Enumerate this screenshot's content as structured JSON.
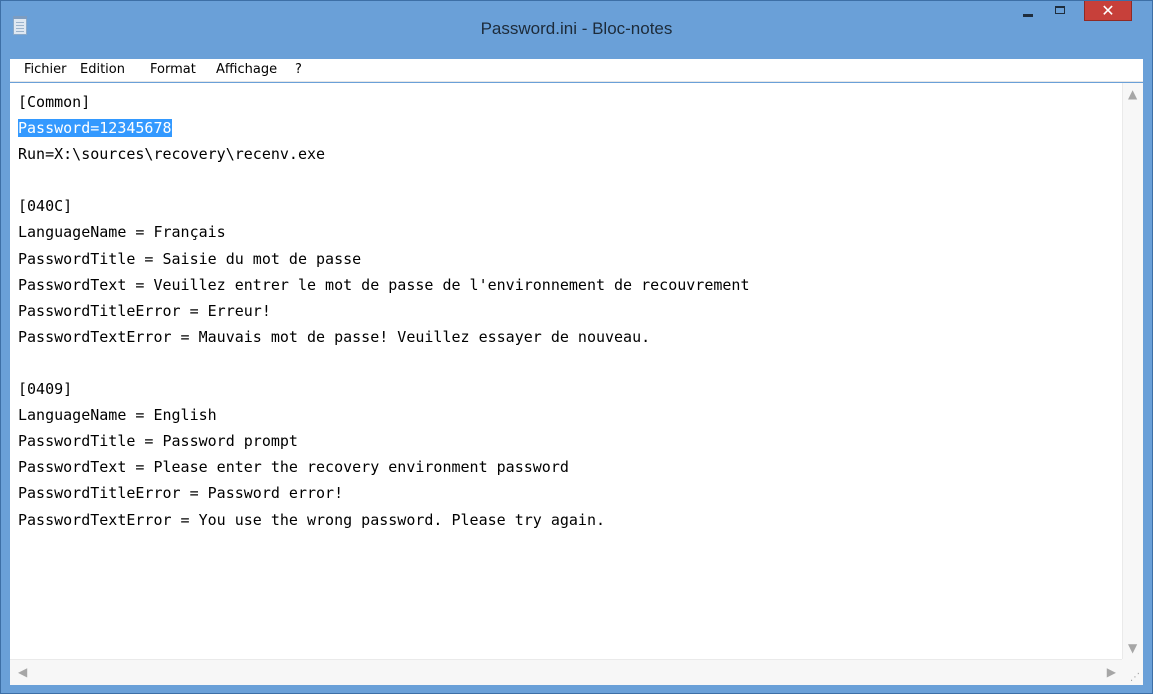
{
  "window": {
    "title": "Password.ini - Bloc-notes",
    "icon": "notepad-icon",
    "controls": {
      "minimize": "minimize-icon",
      "maximize": "maximize-icon",
      "close": "close-icon",
      "close_label": "✕"
    },
    "colors": {
      "titlebar": "#6aa0d8",
      "close": "#c7403a",
      "selection": "#3399ff"
    }
  },
  "menu": [
    "Fichier",
    "Edition",
    "Format",
    "Affichage",
    "?"
  ],
  "document": {
    "lines": [
      "[Common]",
      "Password=12345678",
      "Run=X:\\sources\\recovery\\recenv.exe",
      "",
      "[040C]",
      "LanguageName = Français",
      "PasswordTitle = Saisie du mot de passe",
      "PasswordText = Veuillez entrer le mot de passe de l'environnement de recouvrement",
      "PasswordTitleError = Erreur!",
      "PasswordTextError = Mauvais mot de passe! Veuillez essayer de nouveau.",
      "",
      "[0409]",
      "LanguageName = English",
      "PasswordTitle = Password prompt",
      "PasswordText = Please enter the recovery environment password",
      "PasswordTitleError = Password error!",
      "PasswordTextError = You use the wrong password. Please try again."
    ],
    "selected_line": 1
  },
  "scrollbars": {
    "up": "▲",
    "down": "▼",
    "left": "◀",
    "right": "▶",
    "grip": "⋰"
  }
}
